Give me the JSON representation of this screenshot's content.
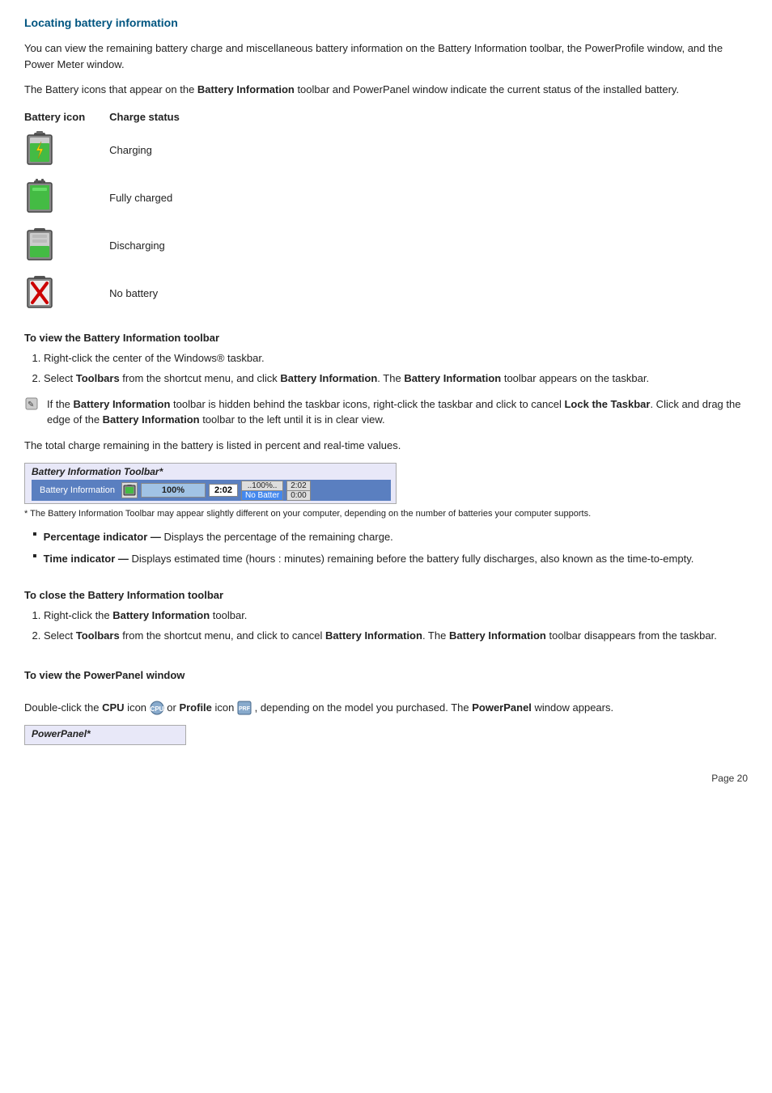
{
  "page": {
    "title": "Locating battery information",
    "intro1": "You can view the remaining battery charge and miscellaneous battery information on the Battery Information toolbar, the PowerProfile window, and the Power Meter window.",
    "intro2_prefix": "The Battery icons that appear on the ",
    "intro2_bold1": "Battery Information",
    "intro2_suffix": " toolbar and PowerPanel window indicate the current status of the installed battery.",
    "battery_table": {
      "col1_header": "Battery icon",
      "col2_header": "Charge status",
      "rows": [
        {
          "status": "Charging"
        },
        {
          "status": "Fully charged"
        },
        {
          "status": "Discharging"
        },
        {
          "status": "No battery"
        }
      ]
    },
    "section_view_toolbar": {
      "heading": "To view the Battery Information toolbar",
      "steps": [
        "Right-click the center of the Windows® taskbar.",
        "Select <b>Toolbars</b> from the shortcut menu, and click <b>Battery Information</b>. The <b>Battery Information</b> toolbar appears on the taskbar."
      ]
    },
    "note1_prefix": "If the ",
    "note1_bold1": "Battery Information",
    "note1_mid": " toolbar is hidden behind the taskbar icons, right-click the taskbar and click to cancel ",
    "note1_bold2": "Lock the Taskbar",
    "note1_mid2": ". Click and drag the edge of the ",
    "note1_bold3": "Battery Information",
    "note1_suffix": " toolbar to the left until it is in clear view.",
    "total_charge_text": "The total charge remaining in the battery is listed in percent and real-time values.",
    "toolbar_preview": {
      "title": "Battery Information Toolbar*",
      "label": "Battery Information",
      "percent_display": "100%",
      "time_display": "2:02",
      "batt_top": "..100%..",
      "batt_bottom": "No Batter",
      "batt2_top": "2:02",
      "batt2_bottom": "0:00"
    },
    "toolbar_footnote": "* The Battery Information Toolbar may appear slightly different on your computer, depending on the number of batteries your computer supports.",
    "bullets": [
      {
        "term": "Percentage indicator —",
        "desc": " Displays the percentage of the remaining charge."
      },
      {
        "term": "Time indicator —",
        "desc": " Displays estimated time (hours : minutes) remaining before the battery fully discharges, also known as the time-to-empty."
      }
    ],
    "section_close_toolbar": {
      "heading": "To close the Battery Information toolbar",
      "steps": [
        "Right-click the <b>Battery Information</b> toolbar.",
        "Select <b>Toolbars</b> from the shortcut menu, and click to cancel <b>Battery Information</b>. The <b>Battery Information</b> toolbar disappears from the taskbar."
      ]
    },
    "section_powerpanel": {
      "heading": "To view the PowerPanel window",
      "desc_prefix": "Double-click the ",
      "desc_cpu": "CPU",
      "desc_mid": " icon ",
      "desc_or": " or ",
      "desc_profile": "Profile",
      "desc_mid2": " icon ",
      "desc_suffix": ", depending on the model you purchased. The ",
      "desc_bold": "PowerPanel",
      "desc_suffix2": " window appears.",
      "toolbar_title": "PowerPanel*"
    },
    "page_number": "Page 20"
  }
}
